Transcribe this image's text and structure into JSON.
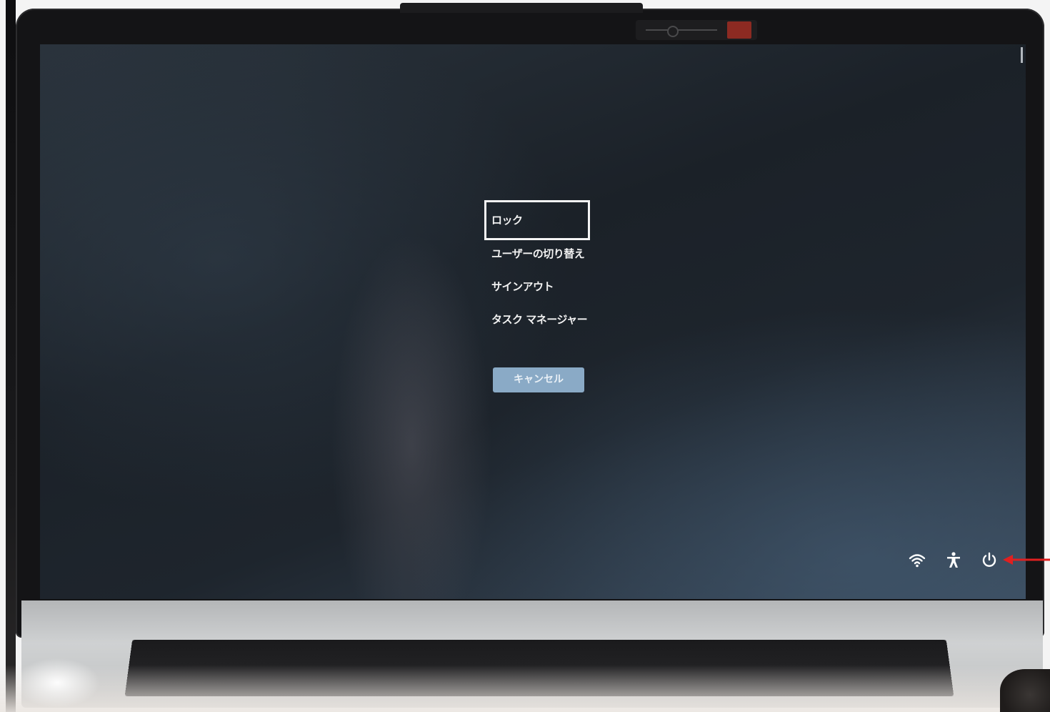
{
  "security_options_menu": {
    "items": [
      {
        "label": "ロック",
        "focused": true
      },
      {
        "label": "ユーザーの切り替え",
        "focused": false
      },
      {
        "label": "サインアウト",
        "focused": false
      },
      {
        "label": "タスク マネージャー",
        "focused": false
      }
    ],
    "cancel_label": "キャンセル"
  },
  "tray": {
    "icons": [
      "wifi-icon",
      "accessibility-icon",
      "power-icon"
    ]
  },
  "annotation": {
    "arrow_color": "#e02020",
    "points_to": "power-icon"
  },
  "colors": {
    "screen_background": "#1f262e",
    "menu_text": "#f2f2f2",
    "focus_border": "#f4f4f4",
    "cancel_button": "#8aaac6"
  }
}
